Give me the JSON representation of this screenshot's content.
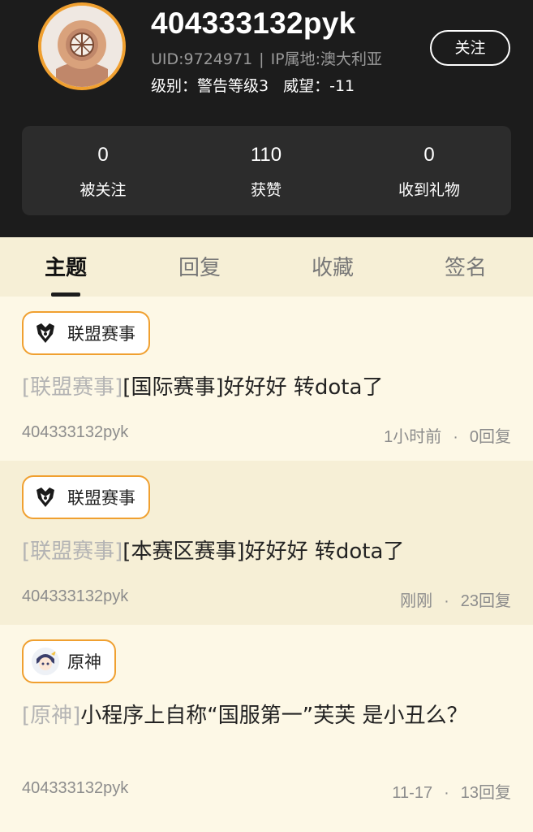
{
  "profile": {
    "username": "404333132pyk",
    "uid": "UID:9724971",
    "ip": "IP属地:澳大利亚",
    "level": "级别：警告等级3",
    "prestige": "威望：-11",
    "follow_label": "关注",
    "avatar_icon": "diving-helmet-avatar"
  },
  "stats": [
    {
      "value": "0",
      "label": "被关注"
    },
    {
      "value": "110",
      "label": "获赞"
    },
    {
      "value": "0",
      "label": "收到礼物"
    }
  ],
  "tabs": [
    {
      "label": "主题",
      "active": true
    },
    {
      "label": "回复",
      "active": false
    },
    {
      "label": "收藏",
      "active": false
    },
    {
      "label": "签名",
      "active": false
    }
  ],
  "posts": [
    {
      "tag": "联盟赛事",
      "tag_icon": "lol-esports-icon",
      "category": "[联盟赛事]",
      "title": "[国际赛事]好好好 转dota了",
      "author": "404333132pyk",
      "time": "1小时前",
      "replies": "0回复"
    },
    {
      "tag": "联盟赛事",
      "tag_icon": "lol-esports-icon",
      "category": "[联盟赛事]",
      "title": "[本赛区赛事]好好好 转dota了",
      "author": "404333132pyk",
      "time": "刚刚",
      "replies": "23回复"
    },
    {
      "tag": "原神",
      "tag_icon": "genshin-icon",
      "category": "[原神]",
      "title": "小程序上自称“国服第一”芙芙 是小丑么？",
      "author": "404333132pyk",
      "time": "11-17",
      "replies": "13回复"
    }
  ],
  "separator": "|",
  "dot": "·",
  "colors": {
    "accent": "#f0a030",
    "header_bg": "#1c1c1c",
    "page_bg": "#fdf8e6",
    "tab_bg": "#f6efd6"
  }
}
